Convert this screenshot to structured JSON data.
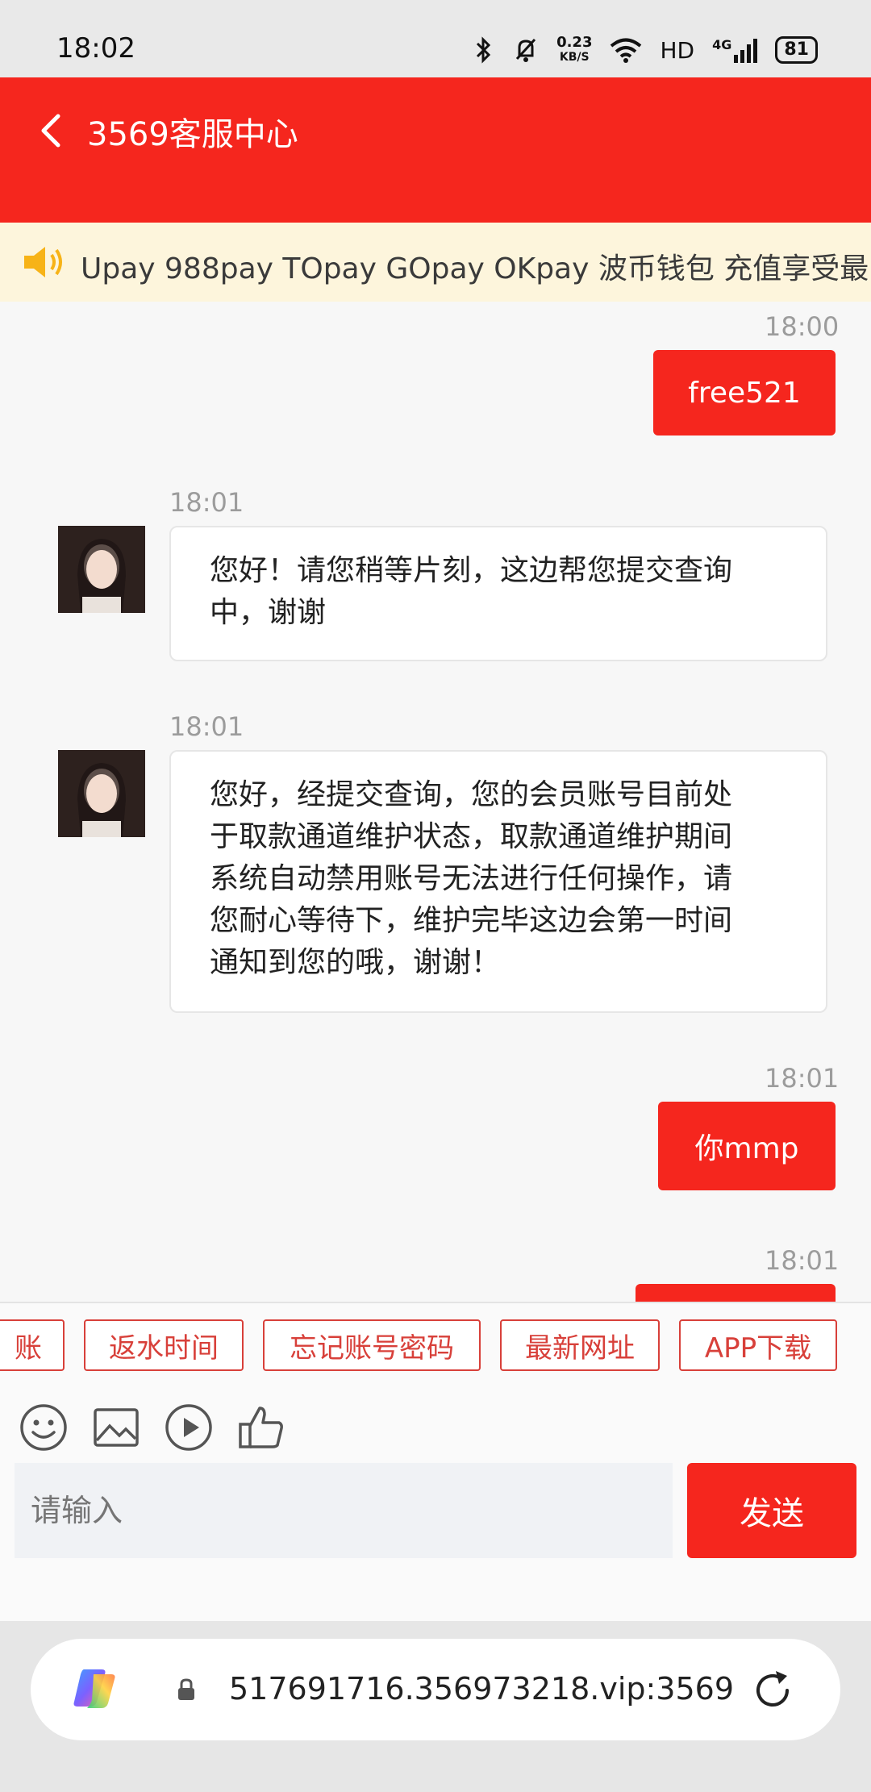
{
  "status_bar": {
    "time": "18:02",
    "net_speed_value": "0.23",
    "net_speed_unit": "KB/S",
    "hd_label": "HD",
    "signal_label": "4G",
    "battery": "81"
  },
  "header": {
    "title": "3569客服中心"
  },
  "notice": {
    "text": "Upay 988pay TOpay GOpay OKpay 波币钱包 充值享受最"
  },
  "messages": [
    {
      "side": "out",
      "time": "18:00",
      "text": "free521"
    },
    {
      "side": "in",
      "time": "18:01",
      "lines": [
        "您好！请您稍等片刻，这边帮您提交查询",
        "中，谢谢"
      ]
    },
    {
      "side": "in",
      "time": "18:01",
      "lines": [
        "您好，经提交查询，您的会员账号目前处",
        "于取款通道维护状态，取款通道维护期间",
        "系统自动禁用账号无法进行任何操作，请",
        "您耐心等待下，维护完毕这边会第一时间",
        "通知到您的哦，谢谢！"
      ]
    },
    {
      "side": "out",
      "time": "18:01",
      "text": "你mmp"
    },
    {
      "side": "out",
      "time": "18:01",
      "text": ""
    }
  ],
  "quick_replies": [
    "账",
    "返水时间",
    "忘记账号密码",
    "最新网址",
    "APP下载"
  ],
  "composer": {
    "placeholder": "请输入",
    "send_label": "发送"
  },
  "browser": {
    "url": "517691716.356973218.vip:3569"
  },
  "colors": {
    "brand_red": "#f5261e",
    "notice_bg": "#fdf5dc",
    "chip_red": "#d8403a"
  }
}
